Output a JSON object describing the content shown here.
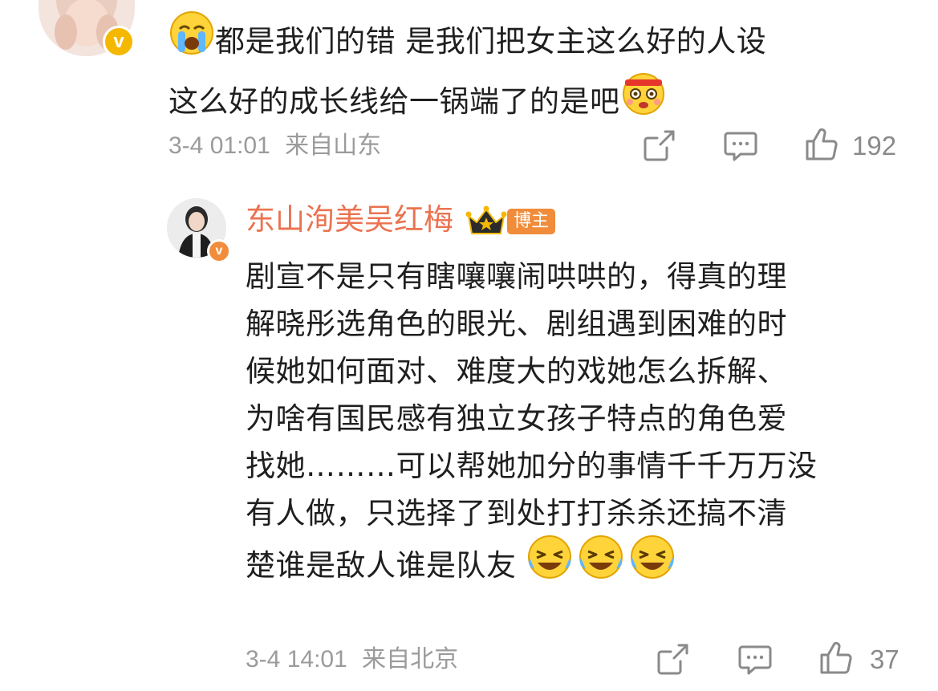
{
  "comment1": {
    "text_line1": "都是我们的错 是我们把女主这么好的人设",
    "text_line2": "这么好的成长线给一锅端了的是吧",
    "timestamp": "3-4 01:01",
    "location": "来自山东",
    "likes": "192",
    "emoji_start": "loudly-crying-face",
    "emoji_end": "headband-face"
  },
  "reply": {
    "author": "东山洵美吴红梅",
    "author_color": "#eb7350",
    "tag": "博主",
    "lines": [
      "剧宣不是只有瞎嚷嚷闹哄哄的，得真的理",
      "解晓彤选角色的眼光、剧组遇到困难的时",
      "候她如何面对、难度大的戏她怎么拆解、",
      "为啥有国民感有独立女孩子特点的角色爱",
      "找她………可以帮她加分的事情千千万万没",
      "有人做，只选择了到处打打杀杀还搞不清",
      "楚谁是敌人谁是队友"
    ],
    "emojis": [
      "laughing-crying-face",
      "laughing-crying-face",
      "laughing-crying-face"
    ],
    "timestamp": "3-4 14:01",
    "location": "来自北京",
    "likes": "37"
  },
  "colors": {
    "text": "#1f1f1f",
    "meta": "#9b9b9b",
    "badge_gold": "#f5b800",
    "badge_orange": "#f08c3a"
  }
}
